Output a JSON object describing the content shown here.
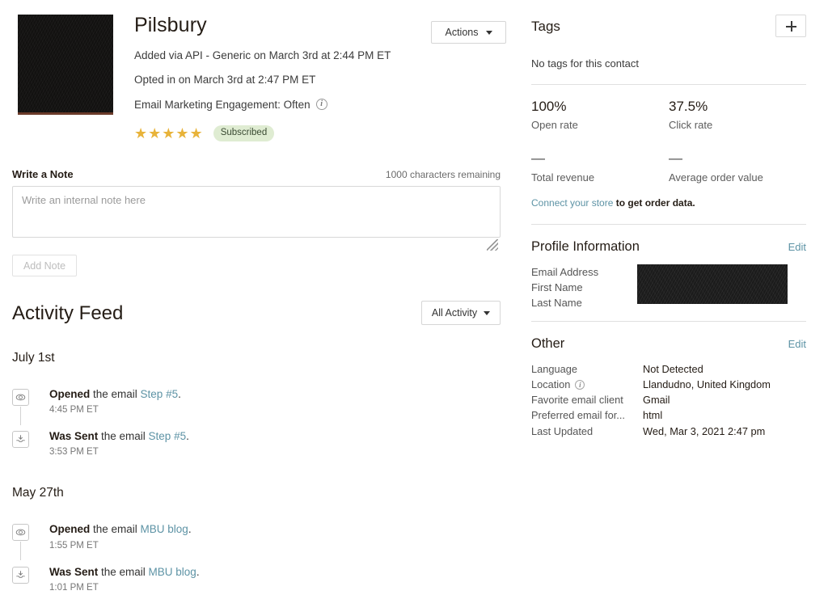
{
  "contact": {
    "name": "Pilsbury",
    "added_line": "Added via API - Generic on March 3rd at 2:44 PM ET",
    "opted_in_line": "Opted in on March 3rd at 2:47 PM ET",
    "engagement_line": "Email Marketing Engagement: Often",
    "stars": "★★★★★",
    "star_count": 5,
    "status_badge": "Subscribed",
    "actions_label": "Actions"
  },
  "note": {
    "label": "Write a Note",
    "characters_remaining": "1000 characters remaining",
    "placeholder": "Write an internal note here",
    "value": "",
    "add_button": "Add Note"
  },
  "activity": {
    "title": "Activity Feed",
    "filter_label": "All Activity",
    "groups": [
      {
        "date": "July 1st",
        "events": [
          {
            "icon": "eye-icon",
            "action": "Opened",
            "middle": " the email ",
            "link": "Step #5",
            "suffix": ".",
            "time": "4:45 PM ET"
          },
          {
            "icon": "inbox-download-icon",
            "action": "Was Sent",
            "middle": " the email ",
            "link": "Step #5",
            "suffix": ".",
            "time": "3:53 PM ET"
          }
        ]
      },
      {
        "date": "May 27th",
        "events": [
          {
            "icon": "eye-icon",
            "action": "Opened",
            "middle": " the email ",
            "link": "MBU blog",
            "suffix": ".",
            "time": "1:55 PM ET"
          },
          {
            "icon": "inbox-download-icon",
            "action": "Was Sent",
            "middle": " the email ",
            "link": "MBU blog",
            "suffix": ".",
            "time": "1:01 PM ET"
          }
        ]
      }
    ]
  },
  "tags": {
    "title": "Tags",
    "add_icon": "plus-icon",
    "empty_text": "No tags for this contact"
  },
  "stats": {
    "open_rate_value": "100%",
    "open_rate_label": "Open rate",
    "click_rate_value": "37.5%",
    "click_rate_label": "Click rate",
    "total_revenue_value": "—",
    "total_revenue_label": "Total revenue",
    "aov_value": "—",
    "aov_label": "Average order value",
    "connect_link": "Connect your store",
    "connect_rest": " to get order data."
  },
  "profile": {
    "title": "Profile Information",
    "edit_label": "Edit",
    "fields": [
      "Email Address",
      "First Name",
      "Last Name"
    ],
    "values_redacted": true
  },
  "other": {
    "title": "Other",
    "edit_label": "Edit",
    "rows": [
      {
        "key": "Language",
        "value": "Not Detected",
        "icon": null
      },
      {
        "key": "Location",
        "value": "Llandudno, United Kingdom",
        "icon": "info-icon"
      },
      {
        "key": "Favorite email client",
        "value": "Gmail",
        "icon": null
      },
      {
        "key": "Preferred email for...",
        "value": "html",
        "icon": null
      },
      {
        "key": "Last Updated",
        "value": "Wed, Mar 3, 2021 2:47 pm",
        "icon": null
      }
    ]
  },
  "colors": {
    "link": "#5d93a5",
    "star": "#e8b33a",
    "badge_bg": "#dfecd2",
    "text": "#241c15",
    "border": "#d6d6d6"
  }
}
